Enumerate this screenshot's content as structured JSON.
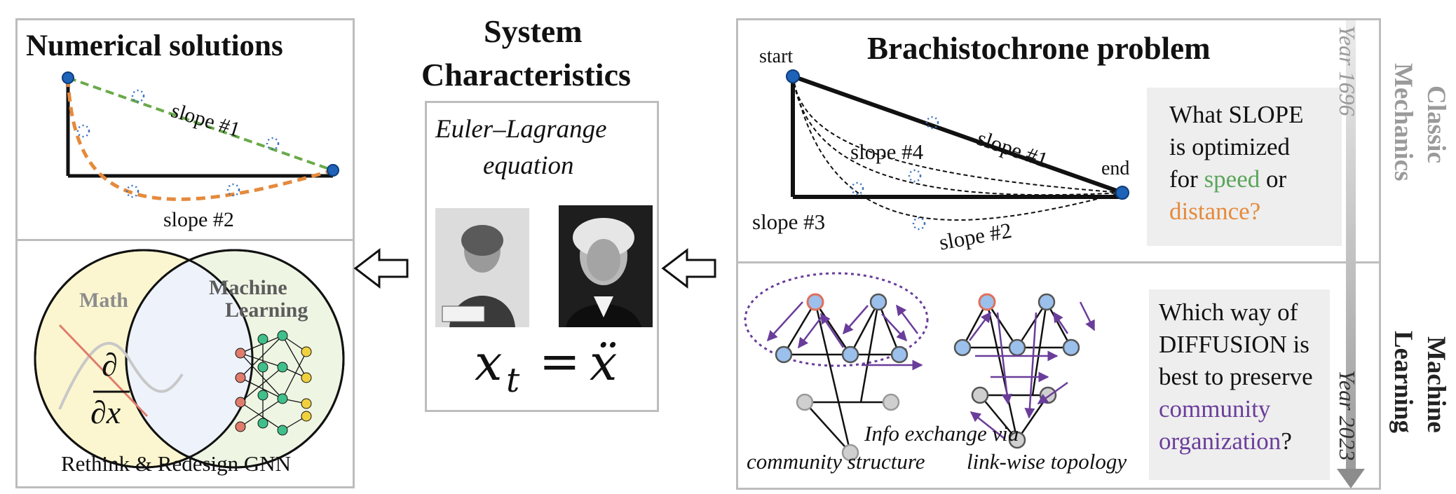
{
  "left": {
    "numerical": {
      "title": "Numerical solutions",
      "slope1": "slope #1",
      "slope2": "slope #2"
    },
    "venn": {
      "math": "Math",
      "ml_line1": "Machine",
      "ml_line2": "Learning",
      "deriv_num": "∂",
      "deriv_den": "∂x",
      "caption": "Rethink & Redesign GNN"
    }
  },
  "middle": {
    "title_line1": "System",
    "title_line2": "Characteristics",
    "eq_line1": "Euler–Lagrange",
    "eq_line2": "equation",
    "formula_lhs": "x",
    "formula_sub": "t",
    "formula_eq": "=",
    "formula_rhs": "ẍ"
  },
  "right": {
    "brach": {
      "title": "Brachistochrone problem",
      "start": "start",
      "end": "end",
      "slope1": "slope #1",
      "slope2": "slope #2",
      "slope3": "slope #3",
      "slope4": "slope #4",
      "q_line1": "What SLOPE",
      "q_line2": "is optimized",
      "q_line3a": "for ",
      "q_speed": "speed",
      "q_line3b": " or",
      "q_distance": "distance?",
      "speed_color": "#5aa55a",
      "distance_color": "#e58a3c"
    },
    "ml": {
      "caption_line1": "Info exchange via",
      "caption_left": "community structure",
      "caption_right": "link-wise topology",
      "q_line1": "Which way of",
      "q_line2": "DIFFUSION is",
      "q_line3": "best to preserve",
      "q_line4": "community",
      "q_line5a": "organization",
      "q_line5b": "?",
      "community_color": "#6a3d9a"
    }
  },
  "timeline": {
    "top_label_line1": "Classic",
    "top_label_line2": "Mechanics",
    "top_year": "Year 1696",
    "bottom_label_line1": "Machine",
    "bottom_label_line2": "Learning",
    "bottom_year": "Year 2023"
  },
  "colors": {
    "green_dashed": "#6aaa4a",
    "orange_dashed": "#e58a3c",
    "node_blue": "#9cc0ec",
    "node_gray": "#cfcfcf",
    "node_red_stroke": "#e0705a",
    "purple_arrow": "#6a3d9a",
    "venn_math_fill": "#fbf6cf",
    "venn_ml_fill": "#eef5e3",
    "venn_overlap_fill": "#eef3fb"
  }
}
